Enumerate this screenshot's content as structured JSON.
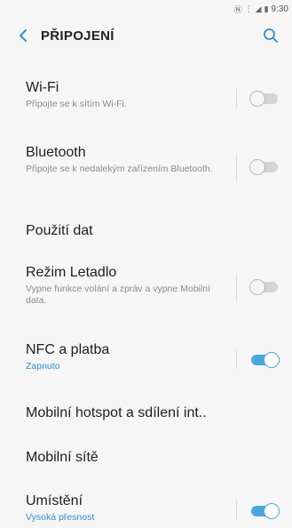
{
  "status": {
    "time": "9:30"
  },
  "header": {
    "title": "PŘIPOJENÍ"
  },
  "items": [
    {
      "label": "Wi-Fi",
      "sub": "Připojte se k sítím Wi-Fi.",
      "on": false
    },
    {
      "label": "Bluetooth",
      "sub": "Připojte se k nedalekým zařízením Bluetooth.",
      "on": false
    },
    {
      "label": "Použití dat"
    },
    {
      "label": "Režim Letadlo",
      "sub": "Vypne funkce volání a zpráv a vypne Mobilní data.",
      "on": false
    },
    {
      "label": "NFC a platba",
      "sub": "Zapnuto",
      "on": true
    },
    {
      "label": "Mobilní hotspot a sdílení int.."
    },
    {
      "label": "Mobilní sítě"
    },
    {
      "label": "Umístění",
      "sub": "Vysoká přesnost",
      "on": true
    }
  ],
  "colors": {
    "accent": "#2f8fce",
    "toggle_on": "#49a7dc",
    "background": "#f6f6f6"
  }
}
